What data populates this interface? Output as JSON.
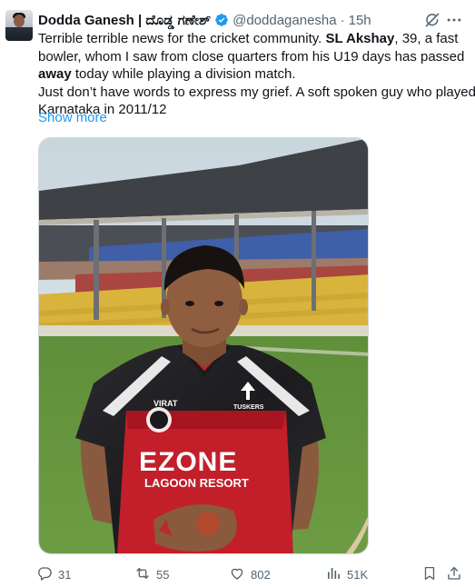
{
  "author": {
    "display_name": "Dodda Ganesh | ದೊಡ್ಡ ಗಣೇಶ್",
    "handle": "@doddaganesha",
    "separator": "·",
    "time": "15h",
    "verified": true
  },
  "tweet": {
    "lines": [
      {
        "pre": "Terrible terrible news for the cricket community. ",
        "bold": "SL Akshay",
        "post": ", 39, a fast"
      },
      {
        "pre": "bowler, whom I saw from close quarters from his U19 days has passed",
        "bold": "",
        "post": ""
      },
      {
        "pre": "",
        "bold": "away",
        "post": " today while playing a division match."
      },
      {
        "pre": "Just don’t have words to express my grief. A soft spoken guy who played for",
        "bold": "",
        "post": ""
      },
      {
        "pre": "Karnataka in 2011/12",
        "bold": "",
        "post": ""
      }
    ],
    "show_more": "Show more"
  },
  "media": {
    "jersey": {
      "brand": "EZONE",
      "sub": "LAGOON RESORT",
      "chest_logo": "VIRAT",
      "team_logo": "TUSKERS"
    }
  },
  "actions": {
    "reply_count": "31",
    "retweet_count": "55",
    "like_count": "802",
    "view_count": "51K"
  },
  "icons": {
    "header": [
      "verified-icon",
      "grok-icon",
      "more-icon"
    ],
    "actions": [
      "reply-icon",
      "retweet-icon",
      "like-icon",
      "views-icon",
      "bookmark-icon",
      "share-icon"
    ]
  },
  "colors": {
    "link": "#1d9bf0",
    "muted": "#536471",
    "verified": "#1d9bf0"
  }
}
